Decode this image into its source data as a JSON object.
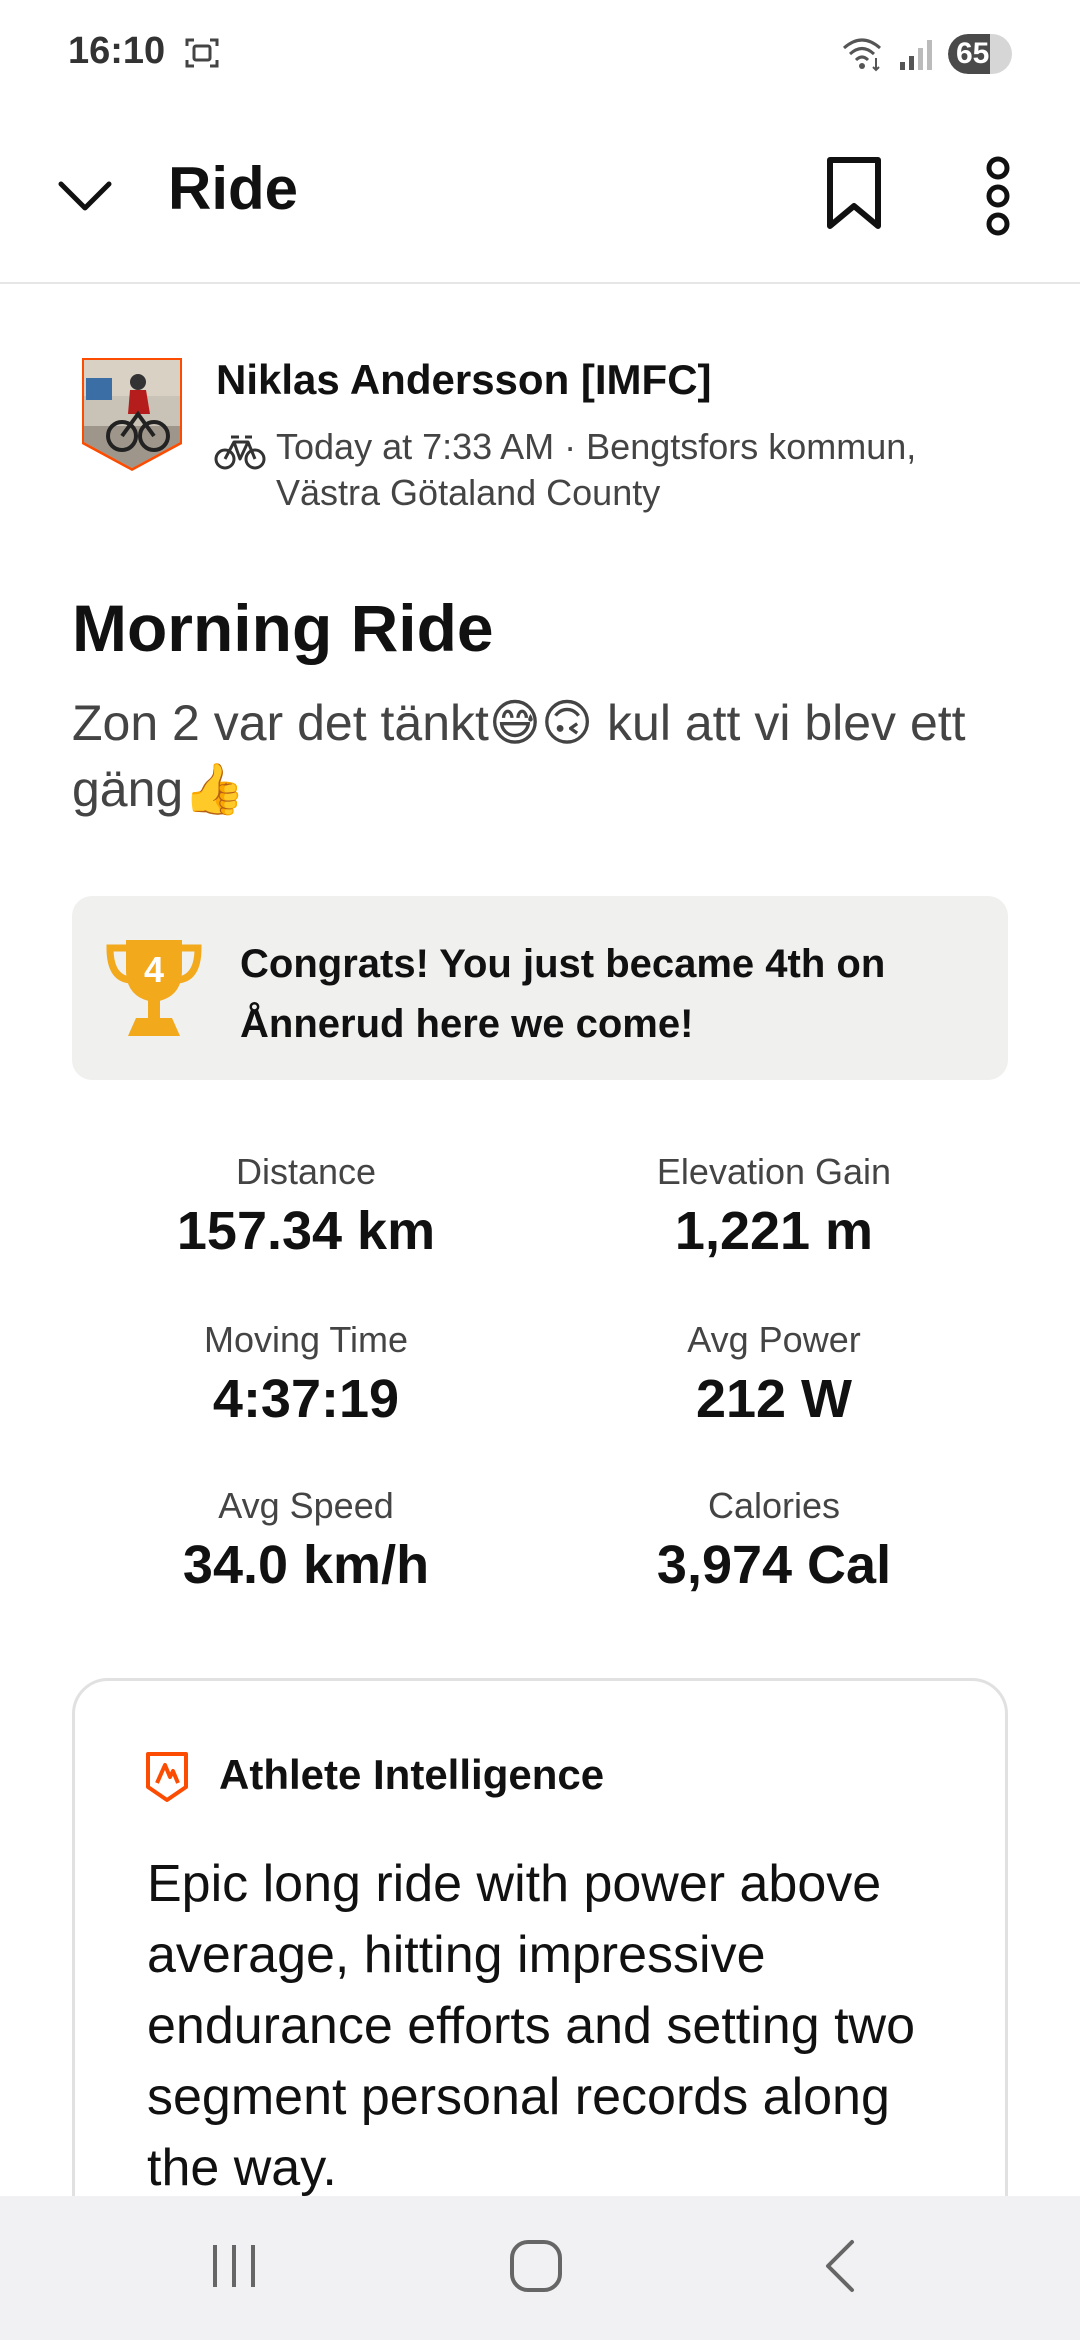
{
  "status_bar": {
    "time": "16:10",
    "battery": "65",
    "battery_level": 0.65,
    "icons": [
      "screen-recorder-icon",
      "wifi-icon",
      "signal-icon",
      "battery-icon"
    ]
  },
  "header": {
    "title": "Ride",
    "icons": [
      "chevron-down-icon",
      "bookmark-icon",
      "more-vertical-icon"
    ]
  },
  "athlete": {
    "name": "Niklas Andersson [IMFC]",
    "activity_icon": "bike-icon",
    "meta": "Today at 7:33 AM · Bengtsfors kommun, Västra Götaland County"
  },
  "activity": {
    "title": "Morning Ride",
    "description": "Zon 2 var det tänkt😅🙃 kul att vi blev ett gäng👍"
  },
  "achievement": {
    "icon": "trophy-icon",
    "rank": "4",
    "text": "Congrats! You just became 4th on Ånnerud here we come!"
  },
  "stats": [
    {
      "label": "Distance",
      "value": "157.34 km"
    },
    {
      "label": "Elevation Gain",
      "value": "1,221 m"
    },
    {
      "label": "Moving Time",
      "value": "4:37:19"
    },
    {
      "label": "Avg Power",
      "value": "212 W"
    },
    {
      "label": "Avg Speed",
      "value": "34.0 km/h"
    },
    {
      "label": "Calories",
      "value": "3,974 Cal"
    }
  ],
  "athlete_intelligence": {
    "heading": "Athlete Intelligence",
    "body": "Epic long ride with power above average, hitting impressive endurance efforts and setting two segment personal records along the way."
  },
  "nav_bar": {
    "icons": [
      "recents-icon",
      "home-icon",
      "back-icon"
    ]
  },
  "colors": {
    "accent": "#fc4c02",
    "trophy": "#f2a91c",
    "text": "#111111",
    "muted_text": "#444444",
    "card_bg": "#f0f0ee"
  }
}
